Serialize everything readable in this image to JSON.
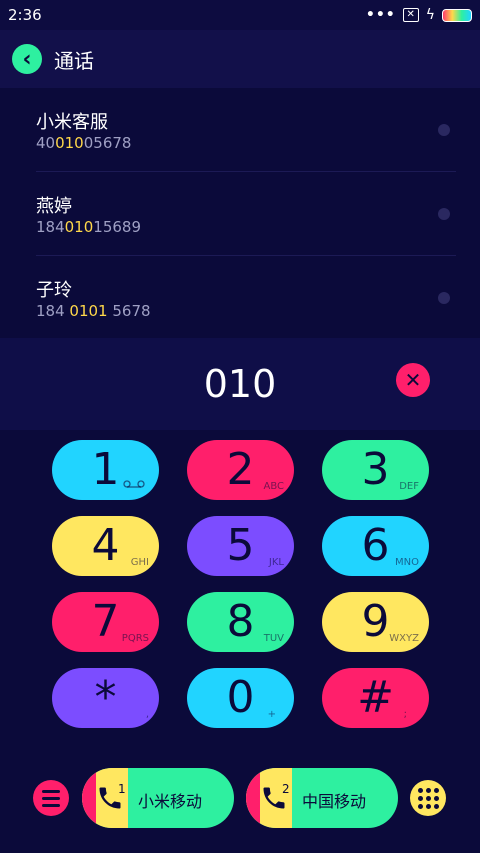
{
  "status_bar": {
    "time": "2:36",
    "dots": "•••",
    "sim_icon": "sim-off-icon",
    "bolt": "ϟ"
  },
  "header": {
    "back_icon": "‹",
    "title": "通话"
  },
  "results": [
    {
      "name": "小米客服",
      "number_pre": "40",
      "number_hl": "010",
      "number_post": "05678"
    },
    {
      "name": "燕婷",
      "number_pre": "184",
      "number_hl": "010",
      "number_post": "15689"
    },
    {
      "name": "子玲",
      "number_pre": "184 ",
      "number_hl": "0101",
      "number_post": " 5678"
    }
  ],
  "dial": {
    "value": "010",
    "clear_icon": "✕"
  },
  "keypad": [
    {
      "digit": "1",
      "sub": "",
      "color": "#21d4ff"
    },
    {
      "digit": "2",
      "sub": "ABC",
      "color": "#ff1f6b"
    },
    {
      "digit": "3",
      "sub": "DEF",
      "color": "#2ef0a0"
    },
    {
      "digit": "4",
      "sub": "GHI",
      "color": "#ffe760"
    },
    {
      "digit": "5",
      "sub": "JKL",
      "color": "#7c4dff"
    },
    {
      "digit": "6",
      "sub": "MNO",
      "color": "#21d4ff"
    },
    {
      "digit": "7",
      "sub": "PQRS",
      "color": "#ff1f6b"
    },
    {
      "digit": "8",
      "sub": "TUV",
      "color": "#2ef0a0"
    },
    {
      "digit": "9",
      "sub": "WXYZ",
      "color": "#ffe760"
    },
    {
      "digit": "*",
      "sub": ",",
      "color": "#7c4dff"
    },
    {
      "digit": "0",
      "sub": "+",
      "color": "#21d4ff"
    },
    {
      "digit": "#",
      "sub": ";",
      "color": "#ff1f6b"
    }
  ],
  "bottom": {
    "sim1": {
      "slot": "1",
      "carrier": "小米移动"
    },
    "sim2": {
      "slot": "2",
      "carrier": "中国移动"
    }
  },
  "colors": {
    "background": "#0b0a3a",
    "cyan": "#21d4ff",
    "red": "#ff1f6b",
    "green": "#2ef0a0",
    "yellow": "#ffe760",
    "purple": "#7c4dff",
    "highlight": "#ffd84a"
  }
}
